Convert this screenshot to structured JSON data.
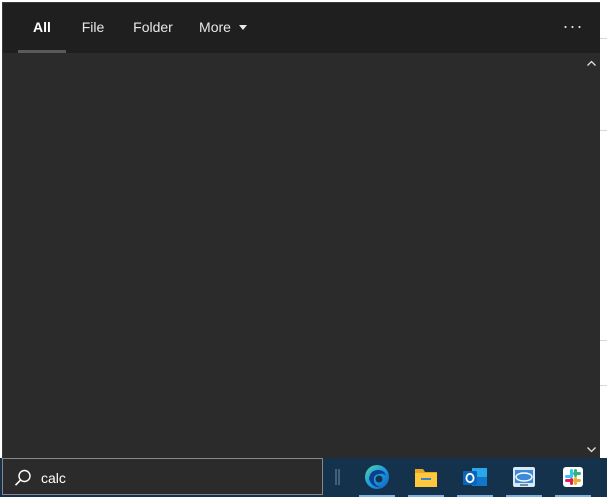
{
  "search_flyout": {
    "tabs": [
      {
        "label": "All",
        "active": true
      },
      {
        "label": "File",
        "active": false
      },
      {
        "label": "Folder",
        "active": false
      },
      {
        "label": "More",
        "active": false
      }
    ],
    "more_options_label": "···"
  },
  "taskbar": {
    "search_query": "calc",
    "search_icon": "search-icon",
    "apps": [
      {
        "name": "Microsoft Edge",
        "icon": "edge-icon"
      },
      {
        "name": "File Explorer",
        "icon": "folder-icon"
      },
      {
        "name": "Outlook",
        "icon": "outlook-icon"
      },
      {
        "name": "Remote Desktop",
        "icon": "remote-desktop-icon"
      },
      {
        "name": "Slack",
        "icon": "slack-icon"
      }
    ]
  },
  "colors": {
    "panel_bg": "#2b2b2b",
    "tabbar_bg": "#1f1f1f",
    "taskbar_bg": "#15324d",
    "indicator": "#7fb2e0"
  }
}
